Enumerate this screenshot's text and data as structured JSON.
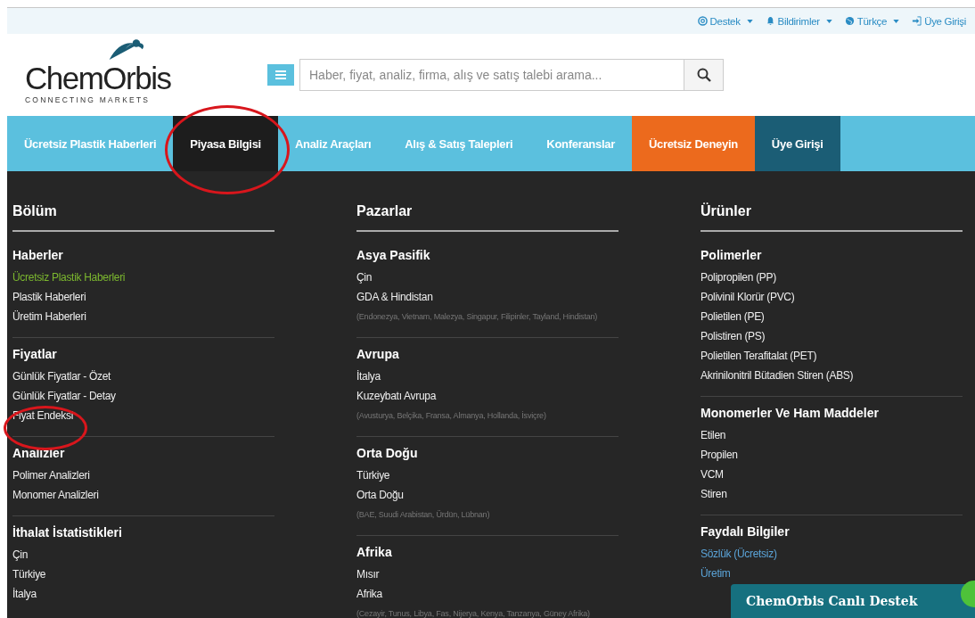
{
  "top_bar": {
    "links": [
      {
        "label": "Destek",
        "kind": "support",
        "caret": true
      },
      {
        "label": "Bildirimler",
        "kind": "bell",
        "caret": true
      },
      {
        "label": "Türkçe",
        "kind": "globe",
        "caret": true
      },
      {
        "label": "Üye Girişi",
        "kind": "signin",
        "caret": false
      }
    ]
  },
  "logo": {
    "name": "ChemOrbis",
    "tagline": "CONNECTING MARKETS"
  },
  "search": {
    "placeholder": "Haber, fiyat, analiz, firma, alış ve satış talebi arama..."
  },
  "nav": [
    {
      "label": "Ücretsiz Plastik Haberleri",
      "kind": "link",
      "selected": false
    },
    {
      "label": "Piyasa Bilgisi",
      "kind": "link",
      "selected": true
    },
    {
      "label": "Analiz Araçları",
      "kind": "link",
      "selected": false
    },
    {
      "label": "Alış & Satış Talepleri",
      "kind": "link",
      "selected": false
    },
    {
      "label": "Konferanslar",
      "kind": "link",
      "selected": false
    },
    {
      "label": "Ücretsiz Deneyin",
      "kind": "trial",
      "selected": false
    },
    {
      "label": "Üye Girişi",
      "kind": "login",
      "selected": false
    }
  ],
  "columns": [
    {
      "title": "Bölüm",
      "sections": [
        {
          "title": "Haberler",
          "items": [
            {
              "label": "Ücretsiz Plastik Haberleri",
              "kind": "featured"
            },
            {
              "label": "Plastik Haberleri",
              "kind": "link"
            },
            {
              "label": "Üretim Haberleri",
              "kind": "link"
            }
          ]
        },
        {
          "title": "Fiyatlar",
          "items": [
            {
              "label": "Günlük Fiyatlar - Özet",
              "kind": "link"
            },
            {
              "label": "Günlük Fiyatlar - Detay",
              "kind": "link"
            },
            {
              "label": "Fiyat Endeksi",
              "kind": "link"
            }
          ]
        },
        {
          "title": "Analizler",
          "items": [
            {
              "label": "Polimer Analizleri",
              "kind": "link"
            },
            {
              "label": "Monomer Analizleri",
              "kind": "link"
            }
          ]
        },
        {
          "title": "İthalat İstatistikleri",
          "items": [
            {
              "label": "Çin",
              "kind": "link"
            },
            {
              "label": "Türkiye",
              "kind": "link"
            },
            {
              "label": "İtalya",
              "kind": "link"
            }
          ]
        }
      ]
    },
    {
      "title": "Pazarlar",
      "sections": [
        {
          "title": "Asya Pasifik",
          "items": [
            {
              "label": "Çin",
              "kind": "link"
            },
            {
              "label": "GDA & Hindistan",
              "kind": "link"
            },
            {
              "label": "(Endonezya, Vietnam, Malezya, Singapur, Filipinler, Tayland, Hindistan)",
              "kind": "note"
            }
          ]
        },
        {
          "title": "Avrupa",
          "items": [
            {
              "label": "İtalya",
              "kind": "link"
            },
            {
              "label": "Kuzeybatı Avrupa",
              "kind": "link"
            },
            {
              "label": "(Avusturya, Belçika, Fransa, Almanya, Hollanda, İsviçre)",
              "kind": "note"
            }
          ]
        },
        {
          "title": "Orta Doğu",
          "items": [
            {
              "label": "Türkiye",
              "kind": "link"
            },
            {
              "label": "Orta Doğu",
              "kind": "link"
            },
            {
              "label": "(BAE, Suudi Arabistan, Ürdün, Lübnan)",
              "kind": "note"
            }
          ]
        },
        {
          "title": "Afrika",
          "items": [
            {
              "label": "Mısır",
              "kind": "link"
            },
            {
              "label": "Afrika",
              "kind": "link"
            },
            {
              "label": "(Cezayir, Tunus, Libya, Fas, Nijerya, Kenya, Tanzanya, Güney Afrika)",
              "kind": "note"
            }
          ]
        }
      ]
    },
    {
      "title": "Ürünler",
      "sections": [
        {
          "title": "Polimerler",
          "items": [
            {
              "label": "Polipropilen (PP)",
              "kind": "link"
            },
            {
              "label": "Polivinil Klorür (PVC)",
              "kind": "link"
            },
            {
              "label": "Polietilen (PE)",
              "kind": "link"
            },
            {
              "label": "Polistiren (PS)",
              "kind": "link"
            },
            {
              "label": "Polietilen Terafitalat (PET)",
              "kind": "link"
            },
            {
              "label": "Akrinilonitril Bütadien Stiren (ABS)",
              "kind": "link"
            }
          ]
        },
        {
          "title": "Monomerler Ve Ham Maddeler",
          "items": [
            {
              "label": "Etilen",
              "kind": "link"
            },
            {
              "label": "Propilen",
              "kind": "link"
            },
            {
              "label": "VCM",
              "kind": "link"
            },
            {
              "label": "Stiren",
              "kind": "link"
            }
          ]
        },
        {
          "title": "Faydalı Bilgiler",
          "items": [
            {
              "label": "Sözlük (Ücretsiz)",
              "kind": "info"
            },
            {
              "label": "Üretim",
              "kind": "info"
            }
          ]
        }
      ]
    }
  ],
  "chat": {
    "title": "ChemOrbis Canlı Destek"
  }
}
